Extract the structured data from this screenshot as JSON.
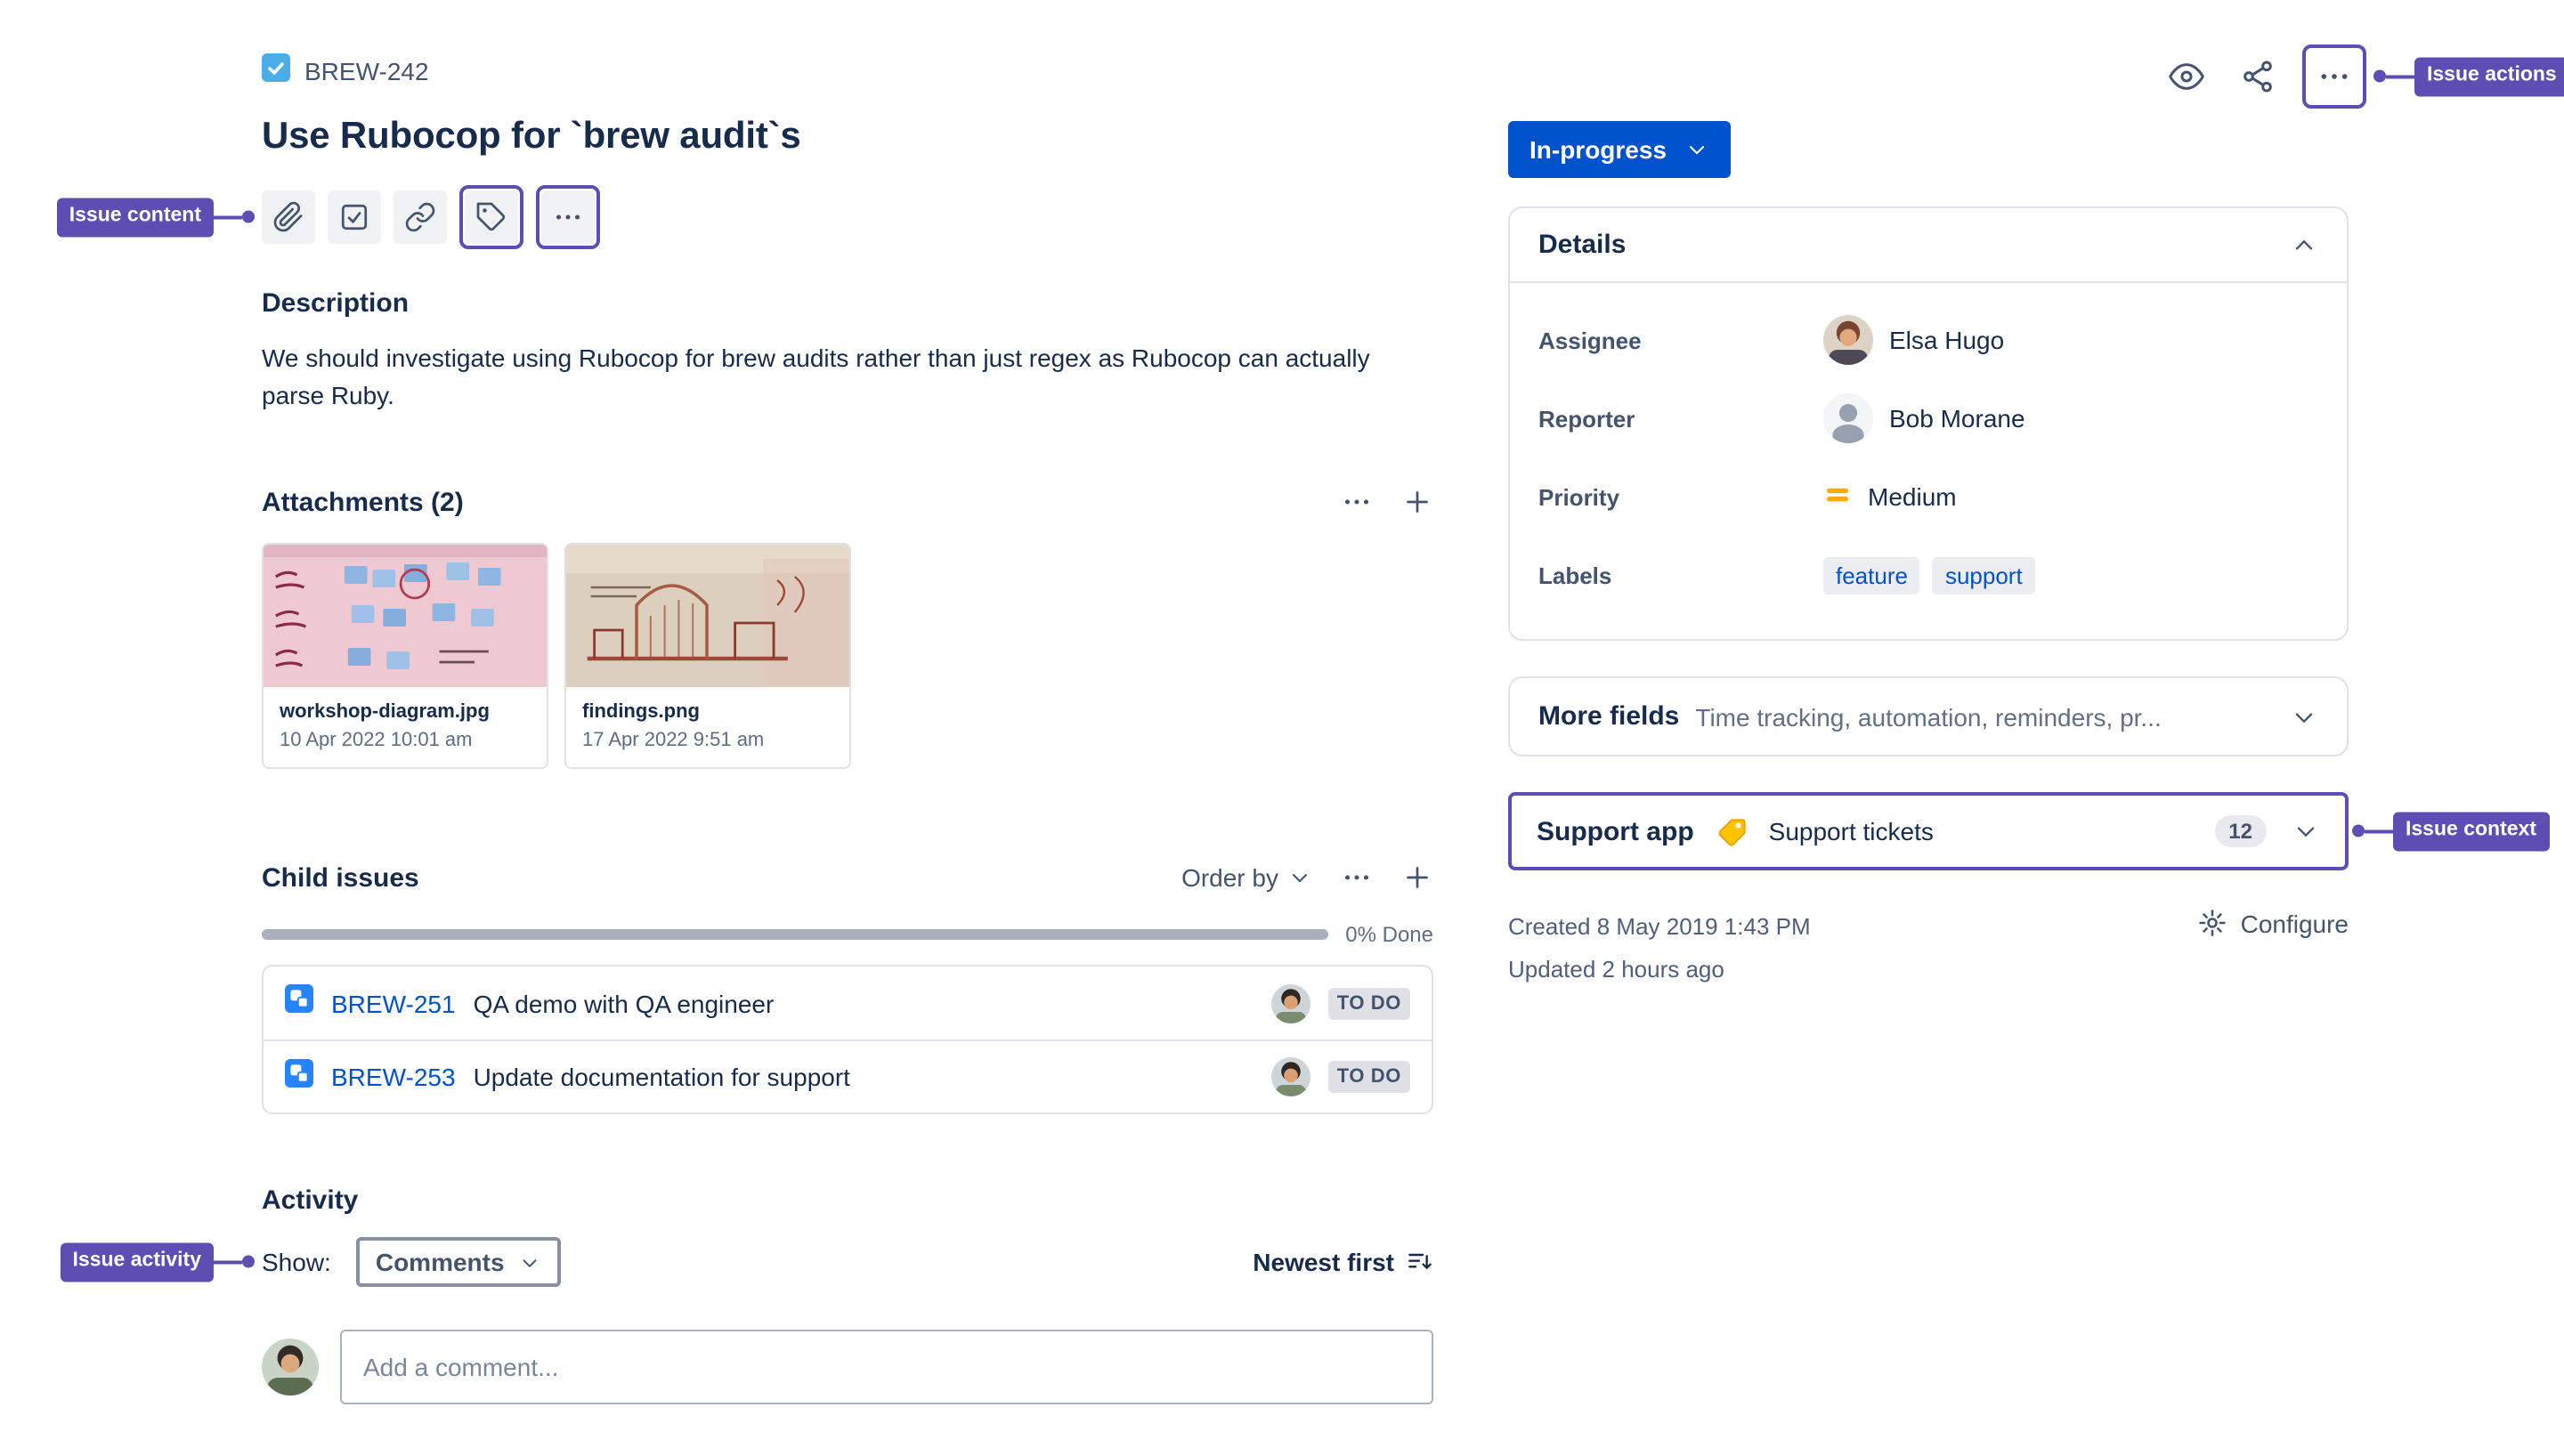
{
  "colors": {
    "annotation_purple": "#5E4DB2",
    "status_button_blue": "#0052CC",
    "link_blue": "#0052CC",
    "priority_medium_orange": "#FFAB00"
  },
  "annotations": {
    "issue_actions": "Issue actions",
    "issue_content": "Issue content",
    "issue_context": "Issue context",
    "issue_activity": "Issue activity"
  },
  "header": {
    "issue_key": "BREW-242",
    "title": "Use Rubocop for `brew audit`s"
  },
  "description": {
    "heading": "Description",
    "body": "We should investigate using Rubocop for brew audits rather than just regex as Rubocop can actually parse Ruby."
  },
  "attachments": {
    "heading": "Attachments (2)",
    "items": [
      {
        "filename": "workshop-diagram.jpg",
        "date": "10 Apr 2022 10:01 am"
      },
      {
        "filename": "findings.png",
        "date": "17 Apr 2022 9:51 am"
      }
    ]
  },
  "child_issues": {
    "heading": "Child issues",
    "order_by_label": "Order by",
    "progress_label": "0% Done",
    "items": [
      {
        "key": "BREW-251",
        "summary": "QA demo with QA engineer",
        "status": "TO DO"
      },
      {
        "key": "BREW-253",
        "summary": "Update documentation for support",
        "status": "TO DO"
      }
    ]
  },
  "activity": {
    "heading": "Activity",
    "show_label": "Show:",
    "filter_value": "Comments",
    "sort_label": "Newest first",
    "comment_placeholder": "Add a comment..."
  },
  "status": {
    "label": "In-progress"
  },
  "details": {
    "heading": "Details",
    "assignee_label": "Assignee",
    "assignee_name": "Elsa Hugo",
    "reporter_label": "Reporter",
    "reporter_name": "Bob Morane",
    "priority_label": "Priority",
    "priority_value": "Medium",
    "labels_label": "Labels",
    "labels": [
      "feature",
      "support"
    ]
  },
  "more_fields": {
    "label": "More fields",
    "summary": "Time tracking, automation, reminders, pr..."
  },
  "support_app": {
    "label": "Support app",
    "name": "Support tickets",
    "count": "12"
  },
  "meta": {
    "created": "Created 8 May 2019 1:43 PM",
    "updated": "Updated 2 hours ago",
    "configure_label": "Configure"
  }
}
